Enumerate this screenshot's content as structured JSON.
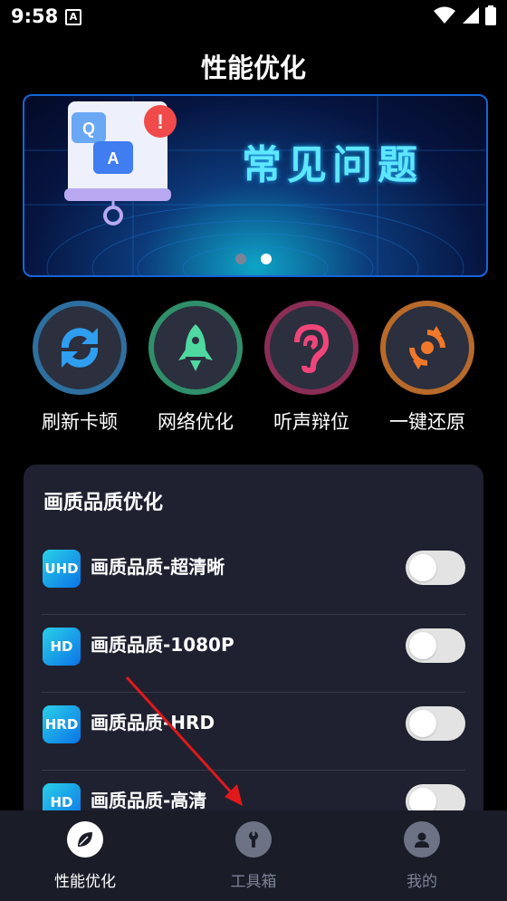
{
  "status": {
    "time": "9:58",
    "notification_icon": "A"
  },
  "header": {
    "title": "性能优化"
  },
  "banner": {
    "title": "常见问题",
    "active_dot": 2,
    "dot_count": 2
  },
  "quick_actions": [
    {
      "label": "刷新卡顿",
      "icon": "refresh-icon",
      "ring": "#2e6f9f"
    },
    {
      "label": "网络优化",
      "icon": "rocket-icon",
      "ring": "#2f8f6a"
    },
    {
      "label": "听声辩位",
      "icon": "ear-icon",
      "ring": "#8a2e55"
    },
    {
      "label": "一键还原",
      "icon": "restore-icon",
      "ring": "#b86a2a"
    }
  ],
  "quality_card": {
    "title": "画质品质优化",
    "items": [
      {
        "badge": "UHD",
        "label": "画质品质-超清晰",
        "enabled": false
      },
      {
        "badge": "HD",
        "label": "画质品质-1080P",
        "enabled": false
      },
      {
        "badge": "HRD",
        "label": "画质品质-HRD",
        "enabled": false
      },
      {
        "badge": "HD",
        "label": "画质品质-高清",
        "enabled": false
      }
    ]
  },
  "bottom_nav": {
    "items": [
      {
        "label": "性能优化",
        "icon": "leaf-icon",
        "active": true
      },
      {
        "label": "工具箱",
        "icon": "wrench-icon",
        "active": false
      },
      {
        "label": "我的",
        "icon": "user-icon",
        "active": false
      }
    ]
  },
  "colors": {
    "accent_blue": "#1565d8",
    "card_bg": "#1f2130",
    "nav_bg": "#1a1c28",
    "annotation_arrow": "#e0191b"
  }
}
